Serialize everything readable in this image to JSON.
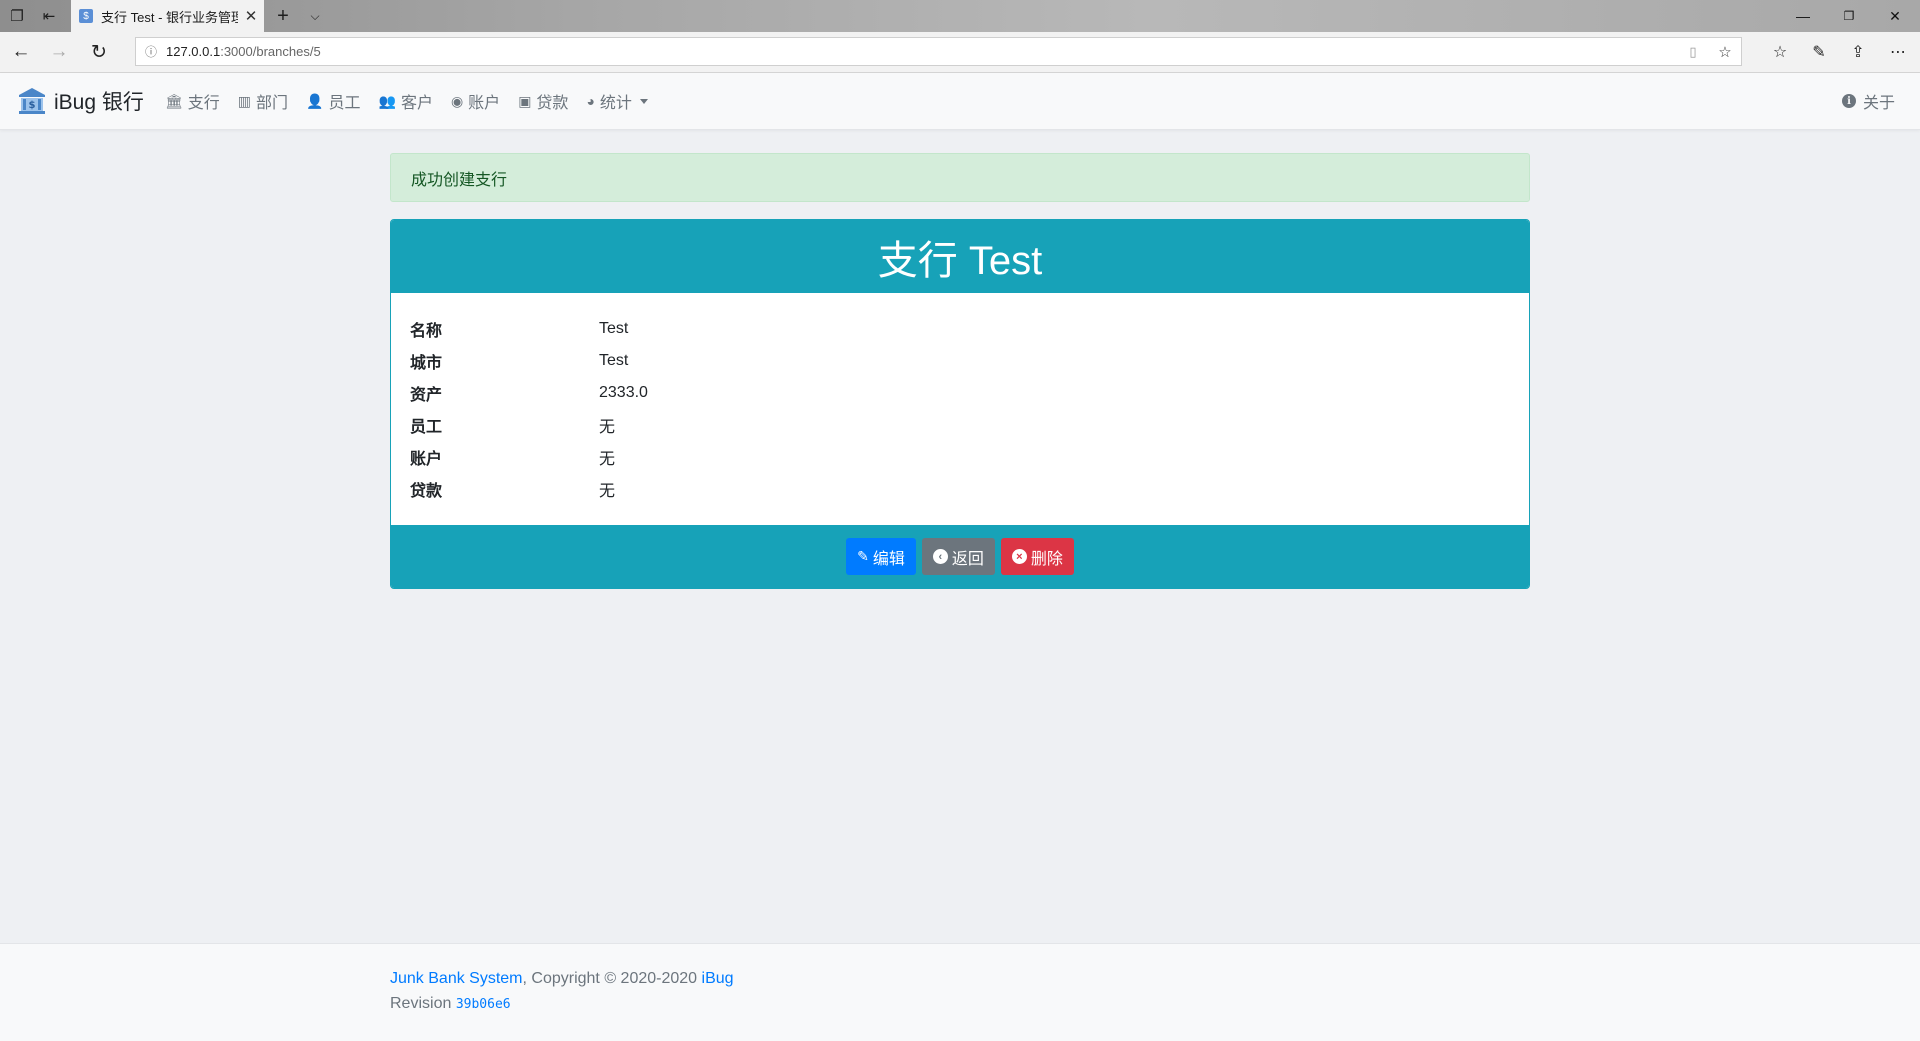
{
  "browser": {
    "tab_title": "支行 Test - 银行业务管理",
    "url_host": "127.0.0.1",
    "url_path": ":3000/branches/5"
  },
  "navbar": {
    "brand": "iBug 银行",
    "menu": [
      {
        "label": "支行",
        "icon": "bank-icon"
      },
      {
        "label": "部门",
        "icon": "building-icon"
      },
      {
        "label": "员工",
        "icon": "user-icon"
      },
      {
        "label": "客户",
        "icon": "users-icon"
      },
      {
        "label": "账户",
        "icon": "user-circle-icon"
      },
      {
        "label": "贷款",
        "icon": "money-bill-icon"
      },
      {
        "label": "统计",
        "icon": "pie-chart-icon"
      }
    ],
    "about": "关于"
  },
  "alert": "成功创建支行",
  "card": {
    "title": "支行 Test",
    "fields": [
      {
        "key": "名称",
        "value": "Test"
      },
      {
        "key": "城市",
        "value": "Test"
      },
      {
        "key": "资产",
        "value": "2333.0"
      },
      {
        "key": "员工",
        "value": "无"
      },
      {
        "key": "账户",
        "value": "无"
      },
      {
        "key": "贷款",
        "value": "无"
      }
    ],
    "buttons": {
      "edit": "编辑",
      "back": "返回",
      "delete": "删除"
    }
  },
  "footer": {
    "system_link": "Junk Bank System",
    "copyright": ", Copyright © 2020-2020 ",
    "author_link": "iBug",
    "revision_label": "Revision ",
    "revision": "39b06e6"
  },
  "colors": {
    "primary": "#007bff",
    "info": "#17a2b8",
    "secondary": "#6c757d",
    "danger": "#dc3545",
    "success_bg": "#d4edda"
  }
}
